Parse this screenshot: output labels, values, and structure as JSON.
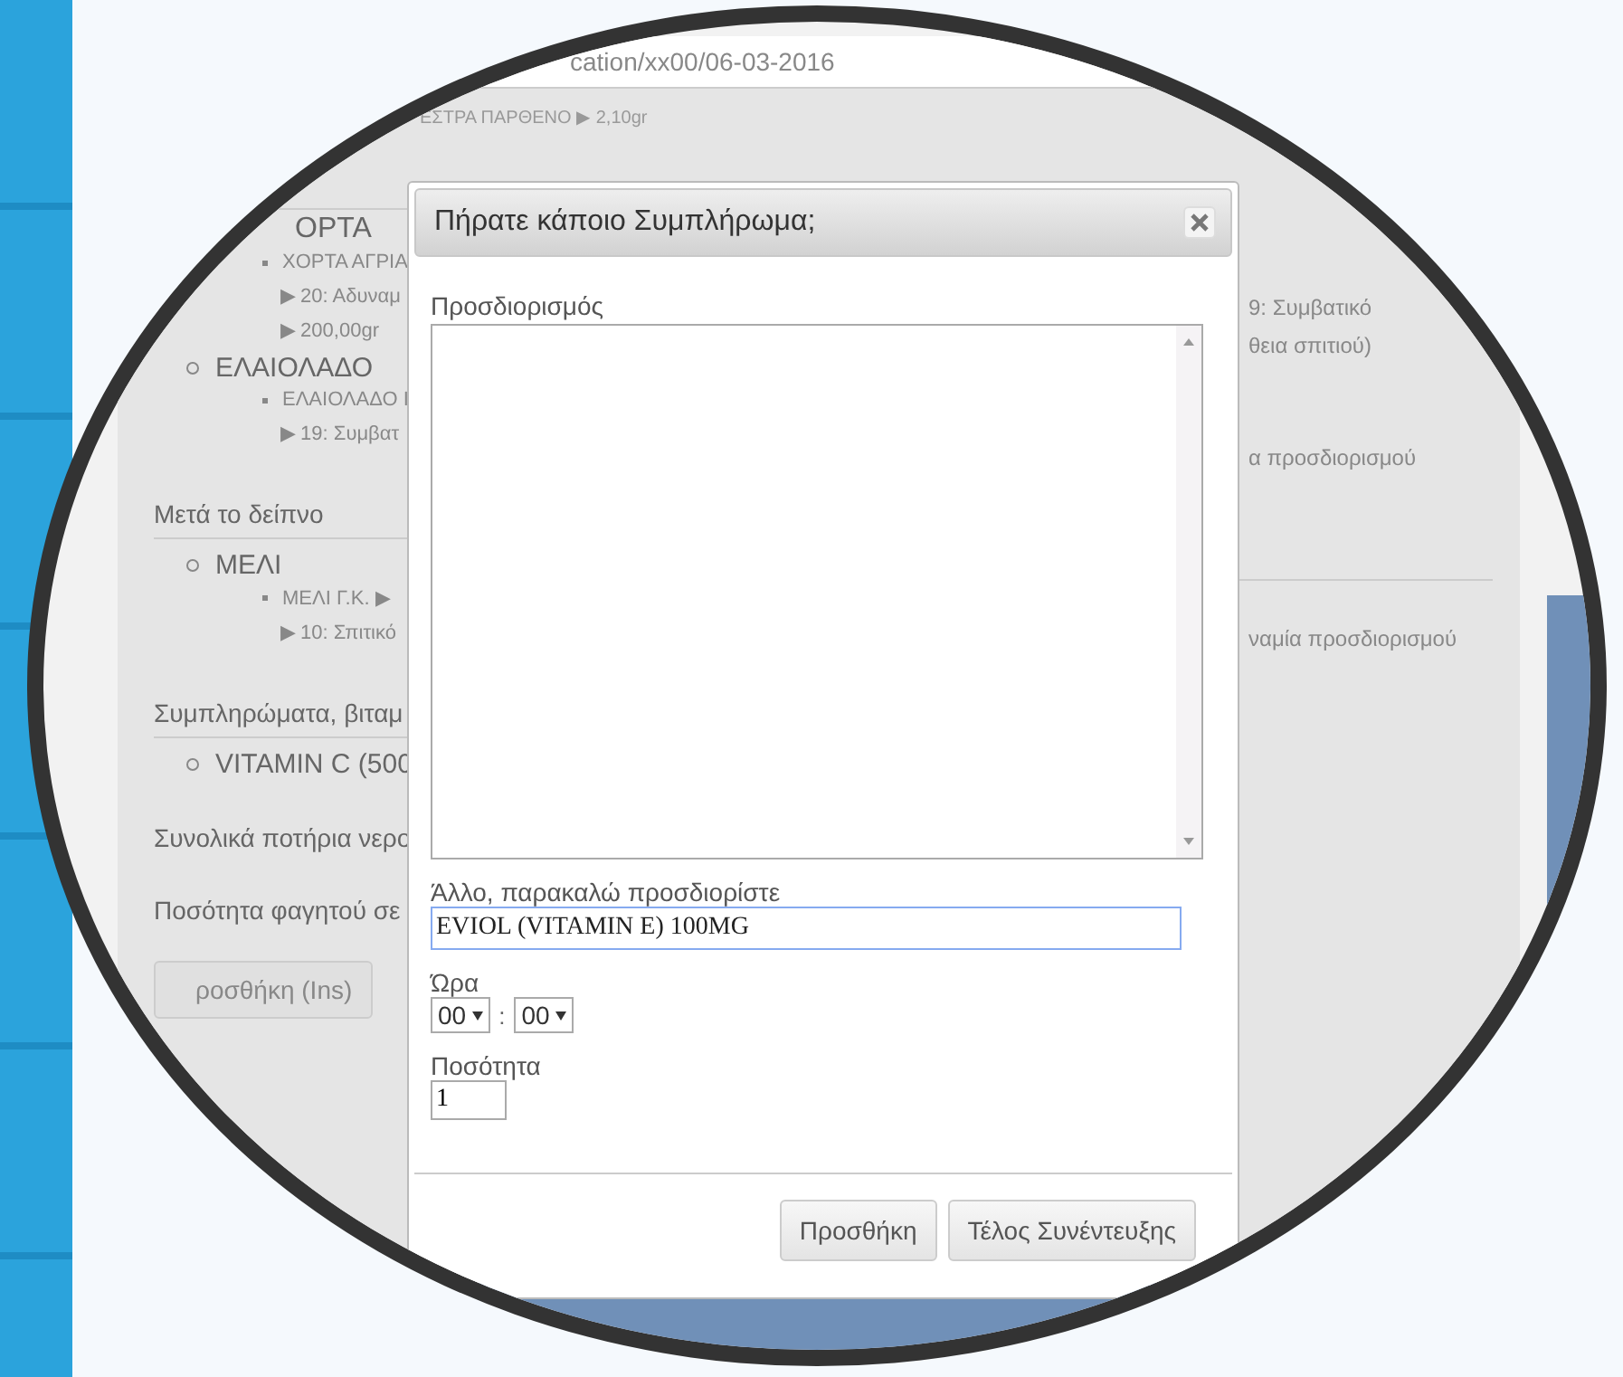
{
  "address_bar": {
    "text": "cation/xx00/06-03-2016"
  },
  "background_page": {
    "top_line": "ΕΣΤΡΑ ΠΑΡΘΕΝΟ ▶ 2,10gr",
    "left_column": [
      {
        "kind": "heading",
        "text": "ΟΡΤΑ"
      },
      {
        "kind": "item",
        "text": "ΧΟΡΤΑ ΑΓΡΙΑ"
      },
      {
        "kind": "detail",
        "text": "▶ 20: Αδυναμ"
      },
      {
        "kind": "detail",
        "text": "▶ 200,00gr"
      },
      {
        "kind": "group",
        "text": "ΕΛΑΙΟΛΑΔΟ"
      },
      {
        "kind": "item",
        "text": "ΕΛΑΙΟΛΑΔΟ Ι"
      },
      {
        "kind": "detail",
        "text": "▶ 19: Συμβατ"
      },
      {
        "kind": "section",
        "text": "Μετά το δείπνο"
      },
      {
        "kind": "group",
        "text": "ΜΕΛΙ"
      },
      {
        "kind": "item",
        "text": "ΜΕΛΙ Γ.Κ. ▶"
      },
      {
        "kind": "detail",
        "text": "▶ 10: Σπιτικό"
      },
      {
        "kind": "section",
        "text": "Συμπληρώματα, βιταμ"
      },
      {
        "kind": "group",
        "text": "VITAMIN C (500"
      },
      {
        "kind": "question",
        "text": "Συνολικά ποτήρια νερο"
      },
      {
        "kind": "question",
        "text": "Ποσότητα φαγητού σε"
      }
    ],
    "right_column": [
      {
        "kind": "detail",
        "text": "9: Συμβατικό"
      },
      {
        "kind": "detail",
        "text": "θεια σπιτιού)"
      },
      {
        "kind": "gap_detail",
        "text": "α προσδιορισμού"
      },
      {
        "kind": "divider_detail",
        "text": "ναμία προσδιορισμού"
      }
    ],
    "buttons": [
      {
        "label": "ροσθήκη (Ins)"
      }
    ]
  },
  "dialog": {
    "title": "Πήρατε κάποιο Συμπλήρωμα;",
    "description_label": "Προσδιορισμός",
    "other_label": "Άλλο, παρακαλώ προσδιορίστε",
    "other_value": "EVIOL (VITAMIN E) 100MG",
    "time_label": "Ώρα",
    "hour": "00",
    "separator": ":",
    "minute": "00",
    "quantity_label": "Ποσότητα",
    "quantity_value": "1",
    "buttons": [
      {
        "label": "Προσθήκη"
      },
      {
        "label": "Τέλος Συνέντευξης"
      }
    ]
  }
}
